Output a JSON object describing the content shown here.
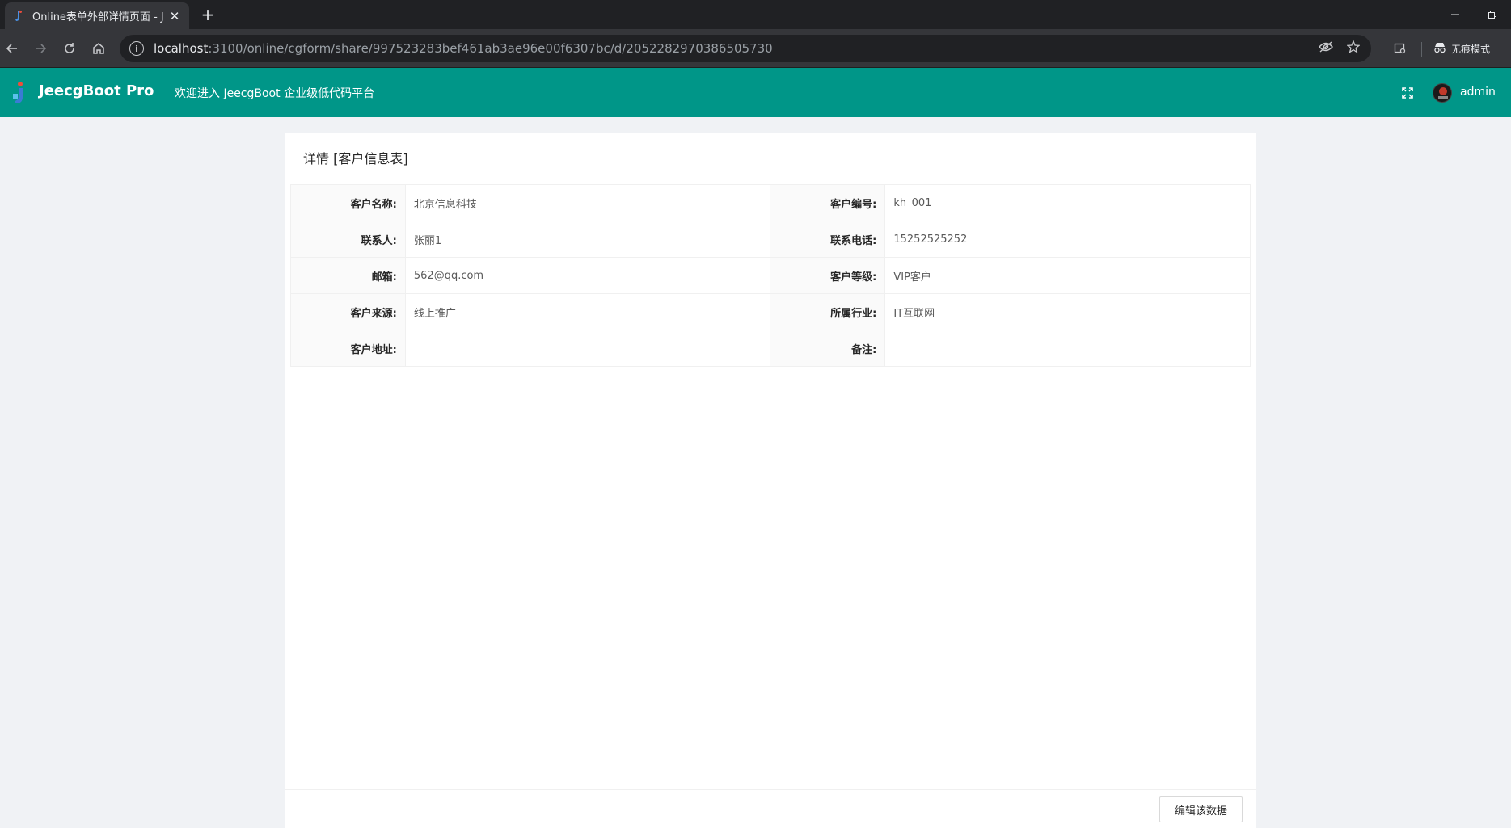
{
  "browser": {
    "tab_title": "Online表单外部详情页面 - Jee",
    "tab_close": "✕",
    "new_tab": "+",
    "url_host": "localhost",
    "url_rest": ":3100/online/cgform/share/997523283bef461ab3ae96e00f6307bc/d/2052282970386505730",
    "incognito_label": "无痕模式"
  },
  "header": {
    "brand": "JeecgBoot Pro",
    "welcome": "欢迎进入 JeecgBoot 企业级低代码平台",
    "username": "admin"
  },
  "card": {
    "title": "详情 [客户信息表]",
    "rows": [
      {
        "l1": "客户名称:",
        "v1": "北京信息科技",
        "l2": "客户编号:",
        "v2": "kh_001"
      },
      {
        "l1": "联系人:",
        "v1": "张丽1",
        "l2": "联系电话:",
        "v2": "15252525252"
      },
      {
        "l1": "邮箱:",
        "v1": "562@qq.com",
        "l2": "客户等级:",
        "v2": "VIP客户"
      },
      {
        "l1": "客户来源:",
        "v1": "线上推广",
        "l2": "所属行业:",
        "v2": "IT互联网"
      },
      {
        "l1": "客户地址:",
        "v1": "",
        "l2": "备注:",
        "v2": ""
      }
    ],
    "edit_button": "编辑该数据"
  },
  "colors": {
    "header_bg": "#009688",
    "page_bg": "#f0f2f5"
  }
}
